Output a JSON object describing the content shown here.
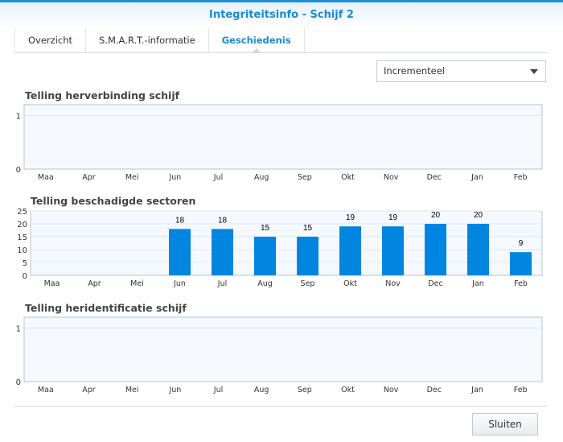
{
  "window": {
    "title": "Integriteitsinfo - Schijf 2"
  },
  "tabs": [
    {
      "label": "Overzicht"
    },
    {
      "label": "S.M.A.R.T.-informatie"
    },
    {
      "label": "Geschiedenis"
    }
  ],
  "mode_select": {
    "value": "Incrementeel"
  },
  "footer": {
    "close_label": "Sluiten"
  },
  "colors": {
    "accent": "#1a8ad0",
    "bar": "#0085e0",
    "plot_bg": "#f5f9fd"
  },
  "chart_data": [
    {
      "type": "bar",
      "title": "Telling herverbinding schijf",
      "categories": [
        "Maa",
        "Apr",
        "Mei",
        "Jun",
        "Jul",
        "Aug",
        "Sep",
        "Okt",
        "Nov",
        "Dec",
        "Jan",
        "Feb"
      ],
      "values": [
        0,
        0,
        0,
        0,
        0,
        0,
        0,
        0,
        0,
        0,
        0,
        0
      ],
      "yticks": [
        "0",
        "1"
      ],
      "ylim": [
        0,
        1.2
      ]
    },
    {
      "type": "bar",
      "title": "Telling beschadigde sectoren",
      "categories": [
        "Maa",
        "Apr",
        "Mei",
        "Jun",
        "Jul",
        "Aug",
        "Sep",
        "Okt",
        "Nov",
        "Dec",
        "Jan",
        "Feb"
      ],
      "values": [
        null,
        null,
        null,
        18,
        18,
        15,
        15,
        19,
        19,
        20,
        20,
        9
      ],
      "labels": [
        "",
        "",
        "",
        "18",
        "18",
        "15",
        "15",
        "19",
        "19",
        "20",
        "20",
        "9"
      ],
      "yticks": [
        "0",
        "5",
        "10",
        "15",
        "20",
        "25"
      ],
      "ylim": [
        0,
        25
      ]
    },
    {
      "type": "bar",
      "title": "Telling heridentificatie schijf",
      "categories": [
        "Maa",
        "Apr",
        "Mei",
        "Jun",
        "Jul",
        "Aug",
        "Sep",
        "Okt",
        "Nov",
        "Dec",
        "Jan",
        "Feb"
      ],
      "values": [
        0,
        0,
        0,
        0,
        0,
        0,
        0,
        0,
        0,
        0,
        0,
        0
      ],
      "yticks": [
        "0",
        "1"
      ],
      "ylim": [
        0,
        1.2
      ]
    }
  ]
}
